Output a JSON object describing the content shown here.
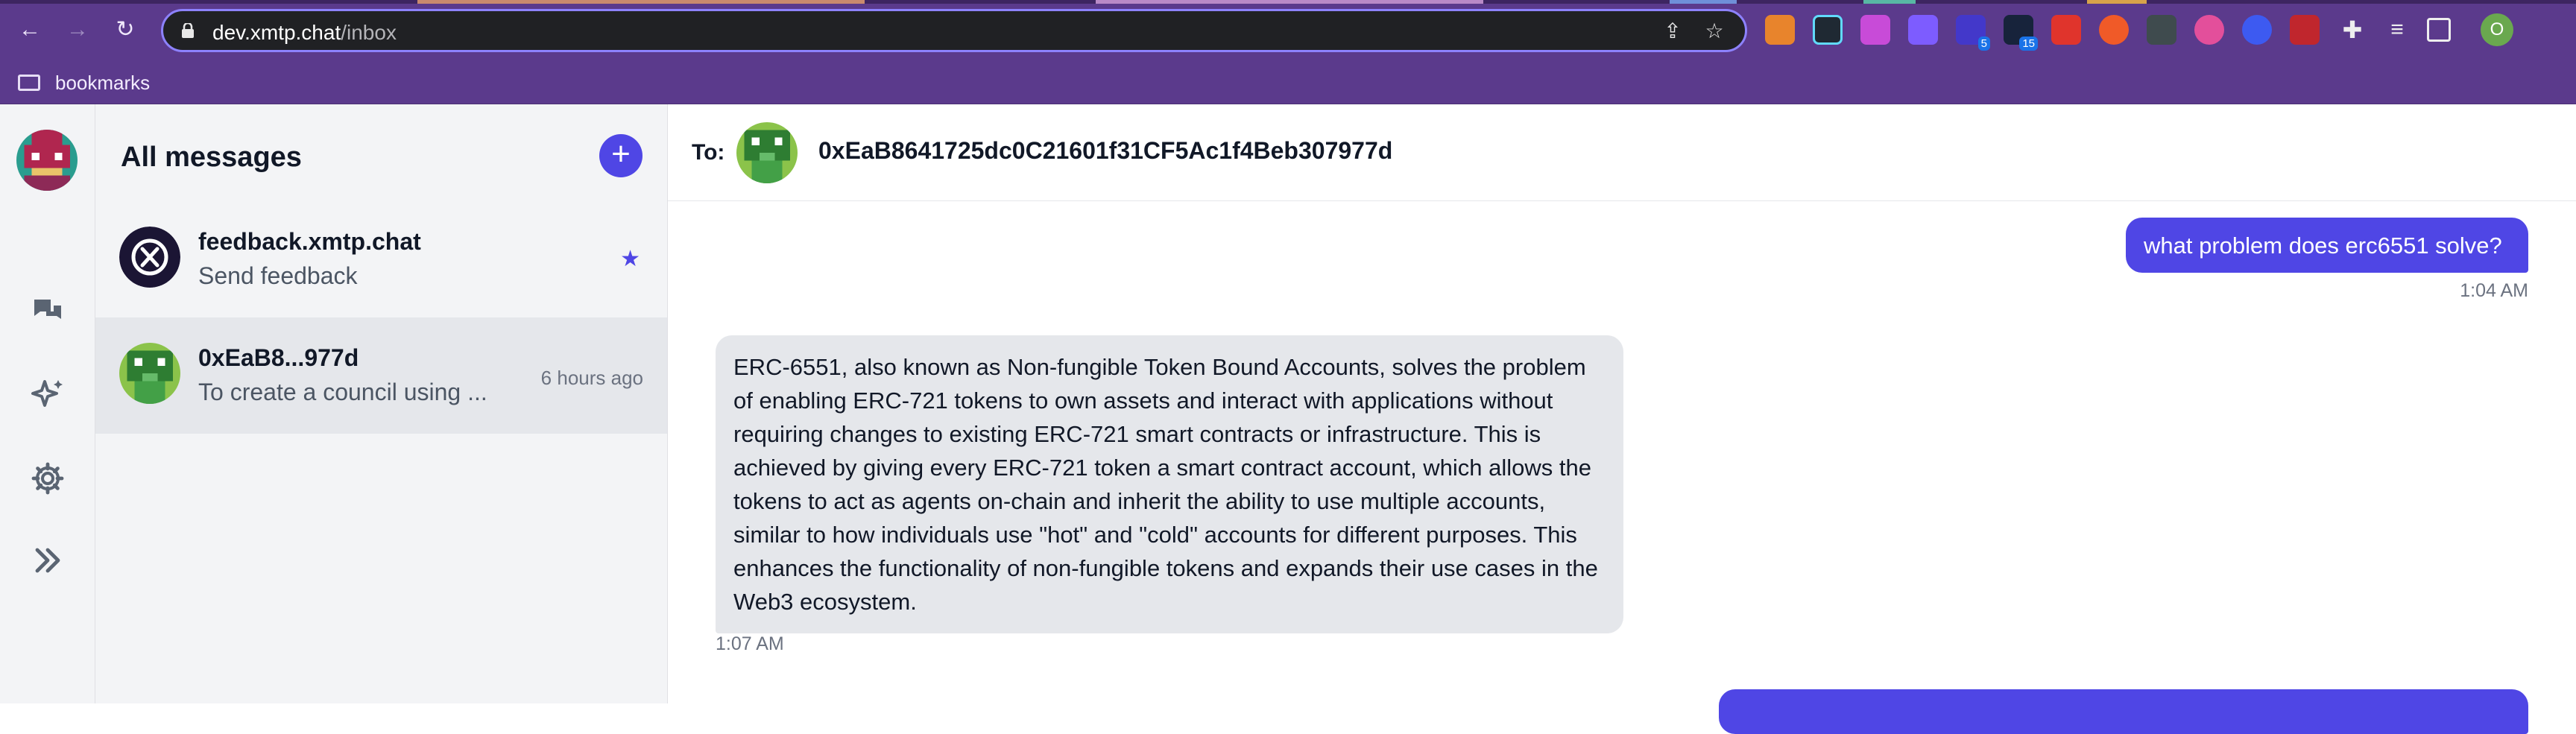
{
  "browser": {
    "url_host": "dev.xmtp.chat",
    "url_path": "/inbox",
    "bookmarks_label": "bookmarks",
    "profile_initial": "O",
    "extension_badges": {
      "ext5": "5",
      "ext6": "15"
    },
    "accent_color": "#5b3a8c"
  },
  "sidebar_nav": {
    "items": [
      "chat-bubbles-icon",
      "sparkles-icon",
      "gear-icon",
      "double-chevron-right-icon"
    ]
  },
  "conversations": {
    "title": "All messages",
    "new_button": "+",
    "items": [
      {
        "name": "feedback.xmtp.chat",
        "preview": "Send feedback",
        "time": "",
        "starred": true
      },
      {
        "name": "0xEaB8...977d",
        "preview": "To create a council using ...",
        "time": "6 hours ago",
        "starred": false
      }
    ]
  },
  "chat": {
    "to_label": "To:",
    "address": "0xEaB8641725dc0C21601f31CF5Ac1f4Beb307977d",
    "messages": [
      {
        "direction": "outgoing",
        "text": "what problem does erc6551 solve?",
        "time": "1:04 AM"
      },
      {
        "direction": "incoming",
        "text": "ERC-6551, also known as Non-fungible Token Bound Accounts, solves the problem of enabling ERC-721 tokens to own assets and interact with applications without requiring changes to existing ERC-721 smart contracts or infrastructure. This is achieved by giving every ERC-721 token a smart contract account, which allows the tokens to act as agents on-chain and inherit the ability to use multiple accounts, similar to how individuals use \"hot\" and \"cold\" accounts for different purposes. This enhances the functionality of non-fungible tokens and expands their use cases in the Web3 ecosystem.",
        "time": "1:07 AM"
      }
    ]
  },
  "colors": {
    "primary": "#4f46e5",
    "incoming_bubble": "#e5e7eb",
    "sidebar_bg": "#f3f4f6"
  }
}
